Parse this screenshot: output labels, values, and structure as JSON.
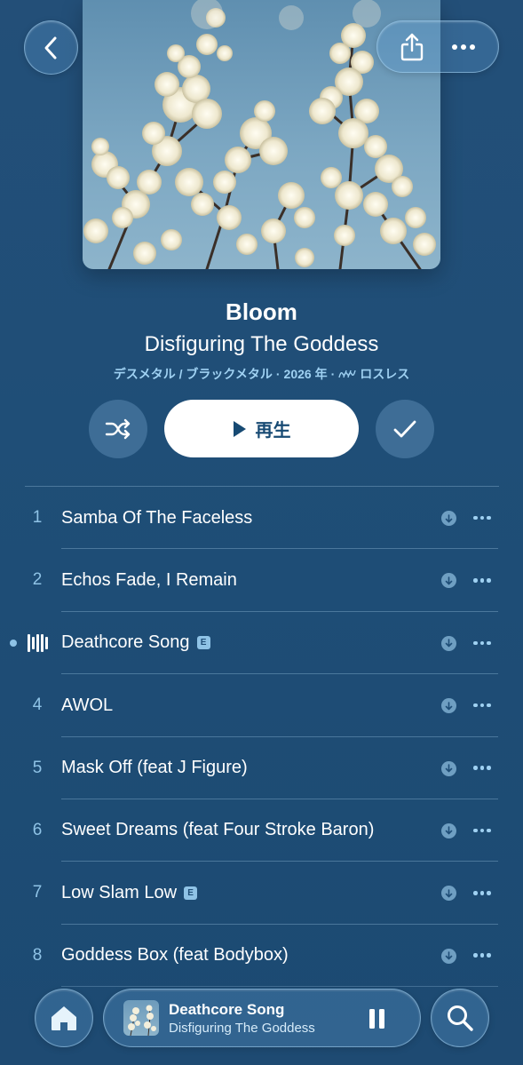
{
  "album": {
    "title": "Bloom",
    "artist": "Disfiguring The Goddess",
    "genre": "デスメタル / ブラックメタル",
    "separator1": "·",
    "year": "2026 年",
    "separator2": "·",
    "quality": "ロスレス"
  },
  "actions": {
    "play_label": "再生"
  },
  "tracks": [
    {
      "number": "1",
      "title": "Samba Of The Faceless",
      "explicit": false,
      "playing": false
    },
    {
      "number": "2",
      "title": "Echos Fade, I Remain",
      "explicit": false,
      "playing": false
    },
    {
      "number": "",
      "title": "Deathcore Song",
      "explicit": true,
      "playing": true
    },
    {
      "number": "4",
      "title": "AWOL",
      "explicit": false,
      "playing": false
    },
    {
      "number": "5",
      "title": "Mask Off (feat J Figure)",
      "explicit": false,
      "playing": false
    },
    {
      "number": "6",
      "title": "Sweet Dreams (feat Four Stroke Baron)",
      "explicit": false,
      "playing": false
    },
    {
      "number": "7",
      "title": "Low Slam Low",
      "explicit": true,
      "playing": false
    },
    {
      "number": "8",
      "title": "Goddess Box (feat Bodybox)",
      "explicit": false,
      "playing": false
    }
  ],
  "explicit_badge": "E",
  "mini_player": {
    "title": "Deathcore Song",
    "artist": "Disfiguring The Goddess"
  },
  "colors": {
    "background": "#1f4e77",
    "accent": "#9fd1f2",
    "play_button": "#ffffff"
  },
  "icons": {
    "back": "chevron-left-icon",
    "share": "share-icon",
    "more": "ellipsis-icon",
    "shuffle": "shuffle-icon",
    "play": "play-icon",
    "added": "checkmark-icon",
    "download": "download-icon",
    "home": "home-icon",
    "pause": "pause-icon",
    "search": "search-icon",
    "lossless": "lossless-icon"
  }
}
